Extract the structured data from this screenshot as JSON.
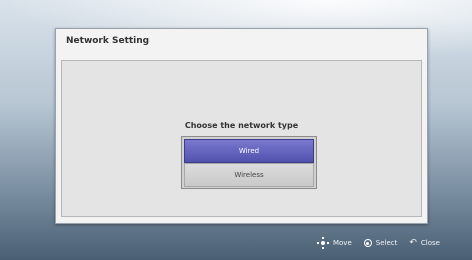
{
  "dialog": {
    "title": "Network Setting",
    "prompt": "Choose the network type",
    "options": [
      {
        "label": "Wired",
        "selected": true
      },
      {
        "label": "Wireless",
        "selected": false
      }
    ]
  },
  "footer": {
    "move_label": "Move",
    "select_label": "Select",
    "close_label": "Close",
    "icons": [
      "dpad-move-icon",
      "select-button-icon",
      "back-close-icon"
    ]
  },
  "colors": {
    "selected_option": "#5b5ab5",
    "background_top": "#d9e2ea",
    "background_bottom": "#4a5f73"
  }
}
